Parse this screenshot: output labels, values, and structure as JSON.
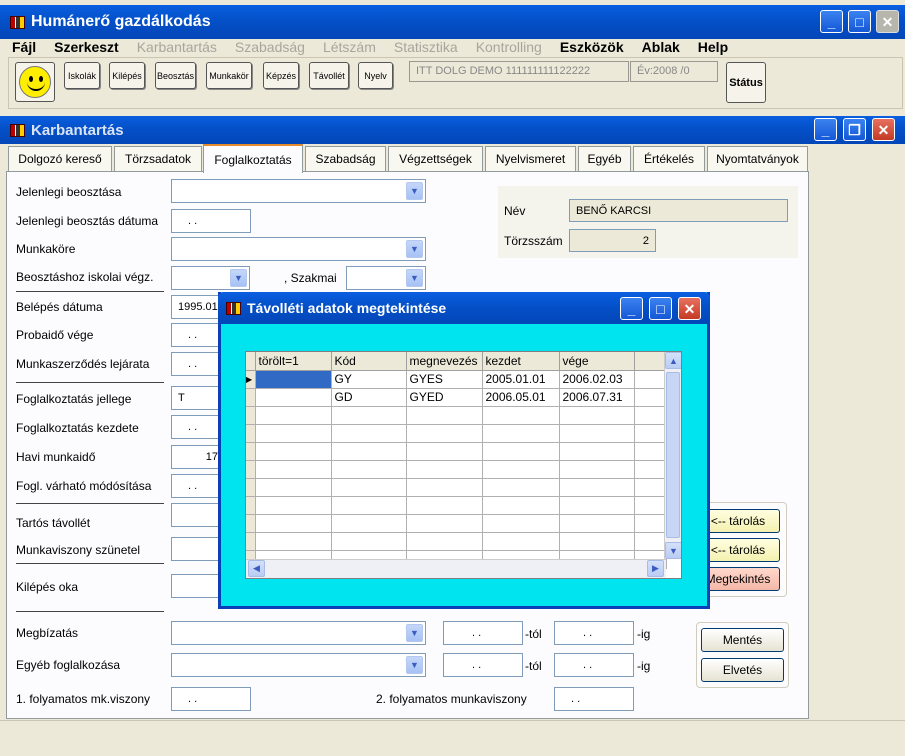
{
  "app": {
    "title": "Humánerő gazdálkodás"
  },
  "menu": {
    "items": [
      "Fájl",
      "Szerkeszt",
      "Karbantartás",
      "Szabadság",
      "Létszám",
      "Statisztika",
      "Kontrolling",
      "Eszközök",
      "Ablak",
      "Help"
    ]
  },
  "toolbar": {
    "buttons": [
      "Iskolák",
      "Kilépés",
      "Beosztás",
      "Munkakör",
      "Képzés",
      "Távollét",
      "Nyelv"
    ],
    "company": "ITT DOLG DEMO 111111111122222",
    "year": "Év:2008 /0",
    "status_label": "Státus"
  },
  "child": {
    "title": "Karbantartás"
  },
  "tabs": [
    "Dolgozó kereső",
    "Törzsadatok",
    "Foglalkoztatás",
    "Szabadság",
    "Végzettségek",
    "Nyelvismeret",
    "Egyéb",
    "Értékelés",
    "Nyomtatványok"
  ],
  "form": {
    "jelenlegi_beosztasa": "Jelenlegi beosztása",
    "jelenlegi_beosztas_datuma": "Jelenlegi beosztás dátuma",
    "munkakore": "Munkaköre",
    "beosztashoz_iskolai": "Beosztáshoz iskolai végz.",
    "szakmai": ", Szakmai",
    "belepes_datuma": "Belépés dátuma",
    "belepes_value": "1995.01",
    "probaido_vege": "Probaidő vége",
    "munkaszerzodes_lejarata": "Munkaszerződés lejárata",
    "foglalkoztatas_jellege": "Foglalkoztatás jellege",
    "jellege_value": "T",
    "foglalkoztatas_kezdete": "Foglalkoztatás kezdete",
    "havi_munkaido": "Havi munkaidő",
    "havi_value": "17",
    "fogl_varhato": "Fogl. várható módósítása",
    "tartos_tavollet": "Tartós távollét",
    "munkaviszony_szunetel": "Munkaviszony szünetel",
    "kilepes_oka": "Kilépés oka",
    "megbizatas": "Megbízatás",
    "egyeb_foglalkozasa": "Egyéb foglalkozása",
    "tol": "-tól",
    "ig": "-ig",
    "folyamatos1": "1. folyamatos mk.viszony",
    "folyamatos2": "2. folyamatos munkaviszony",
    "empty_date": ". .",
    "nev_label": "Név",
    "nev_value": "BENŐ KARCSI",
    "torzsszam_label": "Törzsszám",
    "torzsszam_value": "2",
    "tarolas": "<-- tárolás",
    "megtekintes": "Megtekintés",
    "mentes": "Mentés",
    "elvetes": "Elvetés"
  },
  "dialog": {
    "title": "Távolléti adatok megtekintése",
    "columns": [
      "törölt=1",
      "Kód",
      "megnevezés",
      "kezdet",
      "vége"
    ],
    "rows": [
      [
        "",
        "GY",
        "GYES",
        "2005.01.01",
        "2006.02.03"
      ],
      [
        "",
        "GD",
        "GYED",
        "2006.05.01",
        "2006.07.31"
      ]
    ]
  },
  "colors": {
    "title_blue": "#0450c8",
    "dialog_bg": "#00e4f0",
    "accent_pink": "#f4b8a8"
  }
}
